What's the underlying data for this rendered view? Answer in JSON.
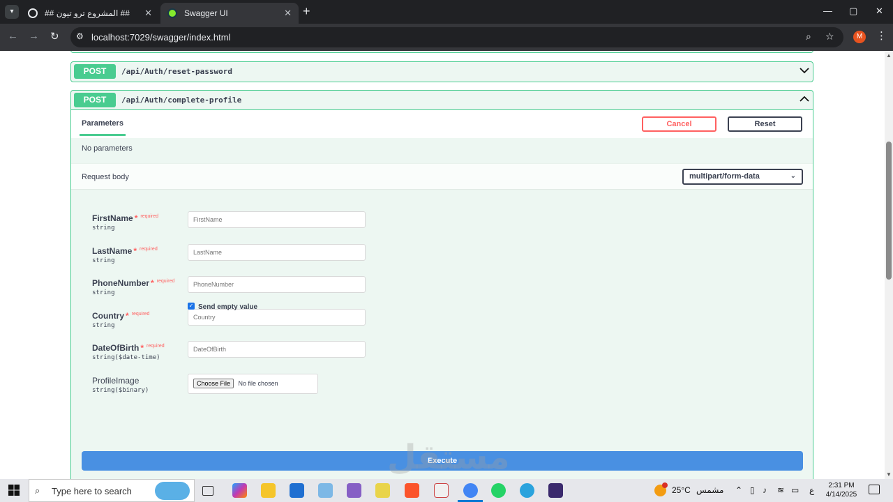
{
  "browser": {
    "tabs": [
      {
        "title": "## المشروع ترو تيون ##"
      },
      {
        "title": "Swagger UI"
      }
    ],
    "url": "localhost:7029/swagger/index.html",
    "profile_initial": "M"
  },
  "operations": [
    {
      "method": "POST",
      "path": "/api/Auth/reset-password",
      "expanded": false
    },
    {
      "method": "POST",
      "path": "/api/Auth/complete-profile",
      "expanded": true
    }
  ],
  "panel": {
    "tab_parameters": "Parameters",
    "cancel_label": "Cancel",
    "reset_label": "Reset",
    "no_parameters": "No parameters",
    "request_body_label": "Request body",
    "content_type": "multipart/form-data",
    "execute_label": "Execute"
  },
  "fields": [
    {
      "name": "FirstName",
      "required_star": "*",
      "required": "required",
      "type": "string",
      "placeholder": "FirstName"
    },
    {
      "name": "LastName",
      "required_star": "*",
      "required": "required",
      "type": "string",
      "placeholder": "LastName"
    },
    {
      "name": "PhoneNumber",
      "required_star": "*",
      "required": "required",
      "type": "string",
      "placeholder": "PhoneNumber"
    },
    {
      "name": "Country",
      "required_star": "*",
      "required": "required",
      "type": "string",
      "placeholder": "Country"
    },
    {
      "name": "DateOfBirth",
      "required_star": "*",
      "required": "required",
      "type": "string($date-time)",
      "placeholder": "DateOfBirth"
    },
    {
      "name": "ProfileImage",
      "type": "string($binary)",
      "file_button": "Choose File",
      "file_status": "No file chosen"
    }
  ],
  "send_empty_value": {
    "label": "Send empty value",
    "checked": true
  },
  "watermark": "مستقل",
  "taskbar": {
    "search_placeholder": "Type here to search",
    "weather_temp": "25°C",
    "weather_text": "مشمس",
    "lang": "ع",
    "time": "2:31 PM",
    "date": "4/14/2025"
  },
  "colors": {
    "post_green": "#49cc90",
    "op_bg": "#edf7f2",
    "cancel_red": "#ff6060",
    "execute_blue": "#4990e2"
  }
}
